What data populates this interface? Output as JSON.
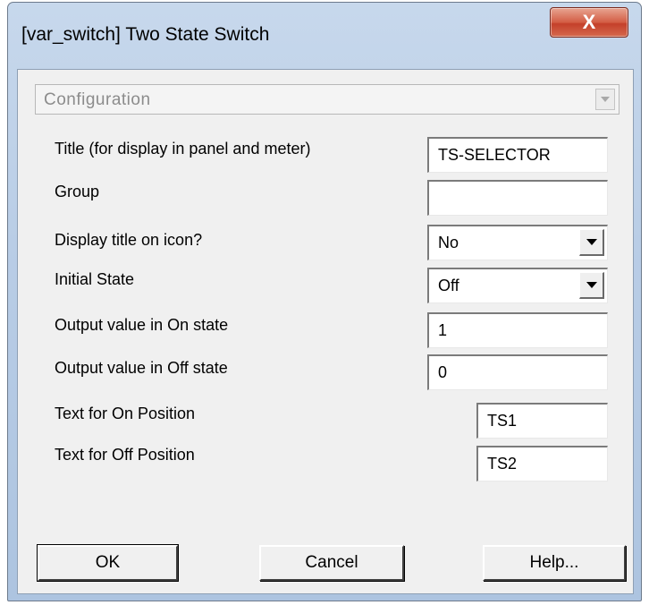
{
  "window": {
    "title": "[var_switch] Two State Switch",
    "close_label": "X"
  },
  "config": {
    "selected": "Configuration"
  },
  "fields": {
    "title": {
      "label": "Title (for display in panel and meter)",
      "value": "TS-SELECTOR"
    },
    "group": {
      "label": "Group",
      "value": ""
    },
    "display_title": {
      "label": "Display title on icon?",
      "value": "No"
    },
    "initial_state": {
      "label": "Initial State",
      "value": "Off"
    },
    "on_value": {
      "label": "Output value in On state",
      "value": "1"
    },
    "off_value": {
      "label": "Output value in Off state",
      "value": "0"
    },
    "on_text": {
      "label": "Text for On Position",
      "value": "TS1"
    },
    "off_text": {
      "label": "Text for Off Position",
      "value": "TS2"
    }
  },
  "buttons": {
    "ok": "OK",
    "cancel": "Cancel",
    "help": "Help..."
  },
  "colors": {
    "title_bar": "#b9cde6",
    "close_button": "#c4402a",
    "client_bg": "#f0f0f0"
  }
}
